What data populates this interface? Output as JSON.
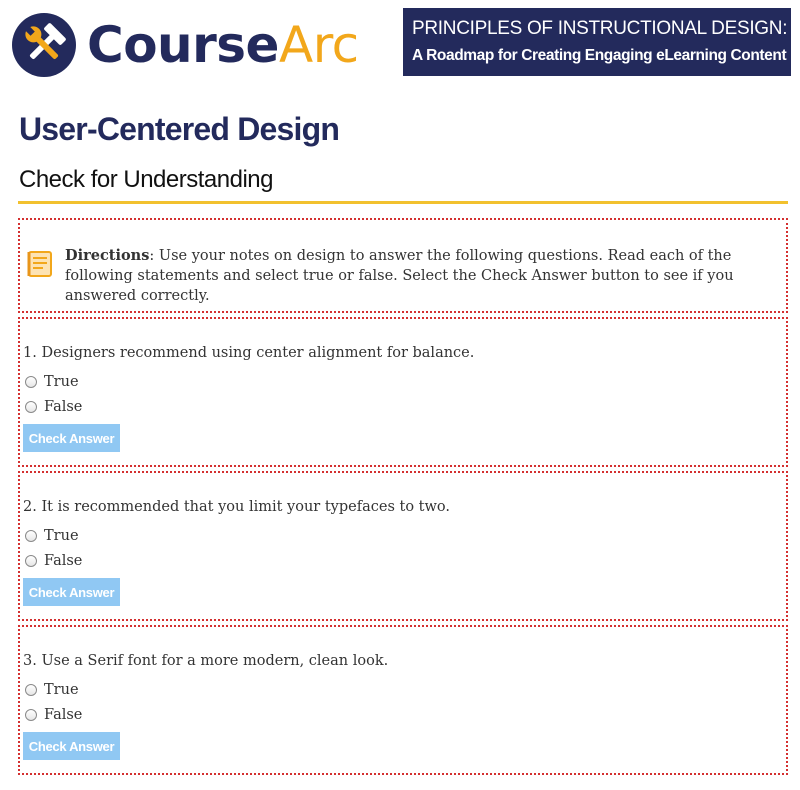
{
  "brand": {
    "logo_part1": "Course",
    "logo_part2": "Arc",
    "logo_icon": "wrench-hammer-icon",
    "colors": {
      "navy": "#232a5c",
      "gold": "#f2a71b",
      "rule": "#f2c12e",
      "button": "#90c8f3",
      "dotted_border": "#d43030"
    }
  },
  "banner": {
    "title": "PRINCIPLES OF INSTRUCTIONAL DESIGN:",
    "subtitle": "A Roadmap for Creating Engaging eLearning Content"
  },
  "page": {
    "title": "User-Centered Design",
    "section_title": "Check for Understanding"
  },
  "directions": {
    "icon": "notes-icon",
    "label": "Directions",
    "text": ": Use your notes on design to answer the following questions. Read each of the following statements and select true or false. Select the Check Answer button to see if you answered correctly."
  },
  "questions": [
    {
      "text": "1. Designers recommend using center alignment for balance.",
      "options": [
        "True",
        "False"
      ],
      "button_label": "Check Answer"
    },
    {
      "text": "2. It is recommended that you limit your typefaces to two.",
      "options": [
        "True",
        "False"
      ],
      "button_label": "Check Answer"
    },
    {
      "text": "3. Use a Serif font for a more modern, clean look.",
      "options": [
        "True",
        "False"
      ],
      "button_label": "Check Answer"
    }
  ]
}
